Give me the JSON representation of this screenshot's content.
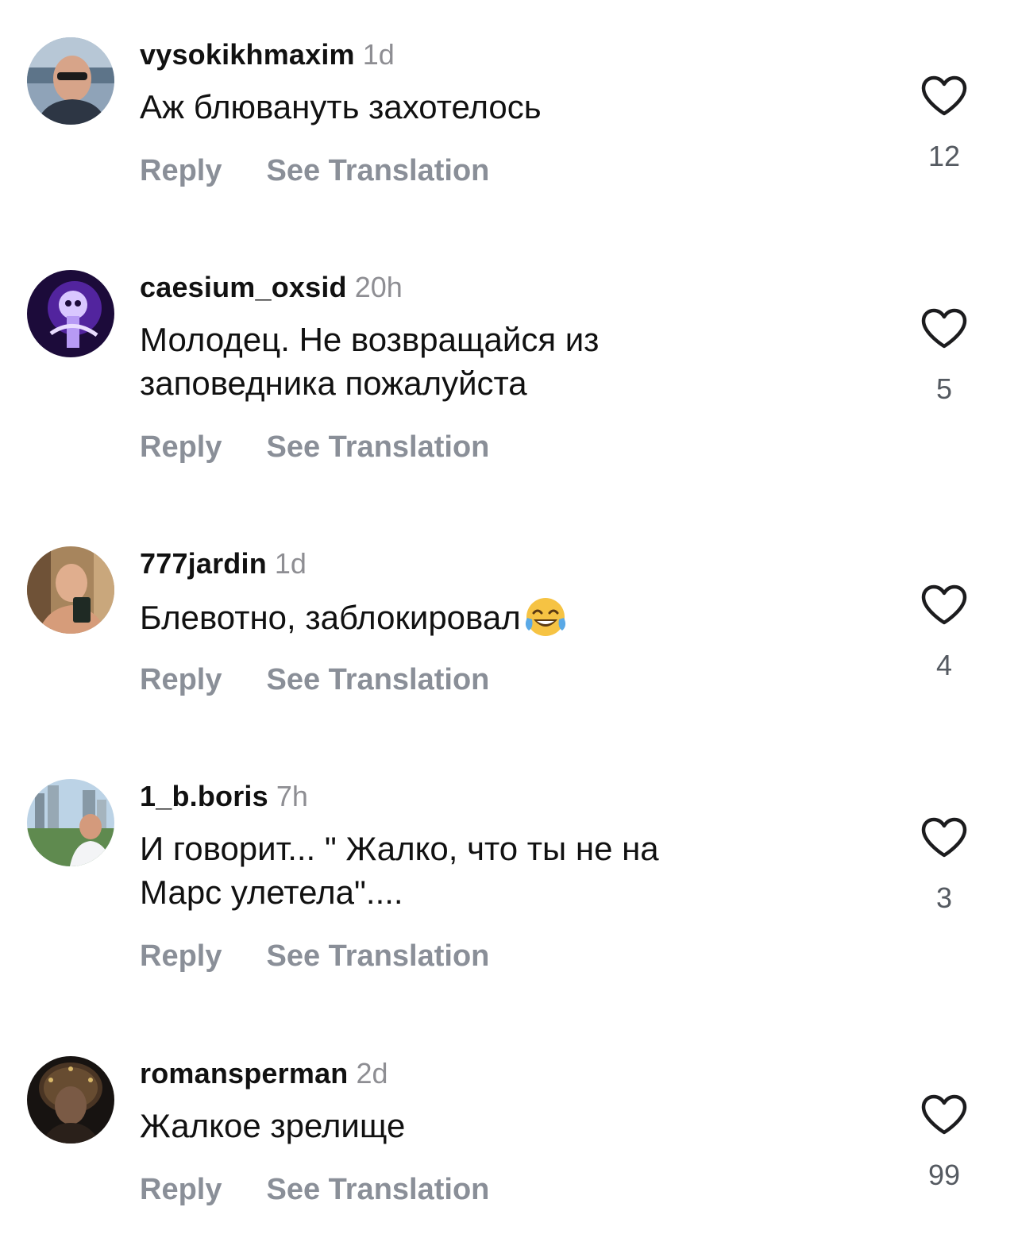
{
  "actions": {
    "reply_label": "Reply",
    "translate_label": "See Translation"
  },
  "comments": [
    {
      "username": "vysokikhmaxim",
      "time": "1d",
      "text_lines": [
        "Аж блювануть захотелось"
      ],
      "likes": "12",
      "avatar_icon": "man-sunglasses-sea-avatar"
    },
    {
      "username": "caesium_oxsid",
      "time": "20h",
      "text_lines": [
        "Молодец. Не возвращайся из",
        "заповедника пожалуйста"
      ],
      "likes": "5",
      "avatar_icon": "purple-skeleton-avatar"
    },
    {
      "username": "777jardin",
      "time": "1d",
      "text_lines": [
        "Блевотно, заблокировал"
      ],
      "likes": "4",
      "avatar_icon": "mirror-selfie-avatar",
      "emoji": "face-with-tears-of-joy"
    },
    {
      "username": "1_b.boris",
      "time": "7h",
      "text_lines": [
        "И говорит... \" Жалко, что ты не на",
        "Марс улетела\"...."
      ],
      "likes": "3",
      "avatar_icon": "man-city-background-avatar"
    },
    {
      "username": "romansperman",
      "time": "2d",
      "text_lines": [
        "Жалкое зрелище"
      ],
      "likes": "99",
      "avatar_icon": "dark-headdress-portrait-avatar"
    }
  ],
  "colors": {
    "text": "#111111",
    "muted": "#8e8e93",
    "action": "#8a8f98",
    "heart_stroke": "#1c1c1e",
    "background": "#ffffff"
  }
}
